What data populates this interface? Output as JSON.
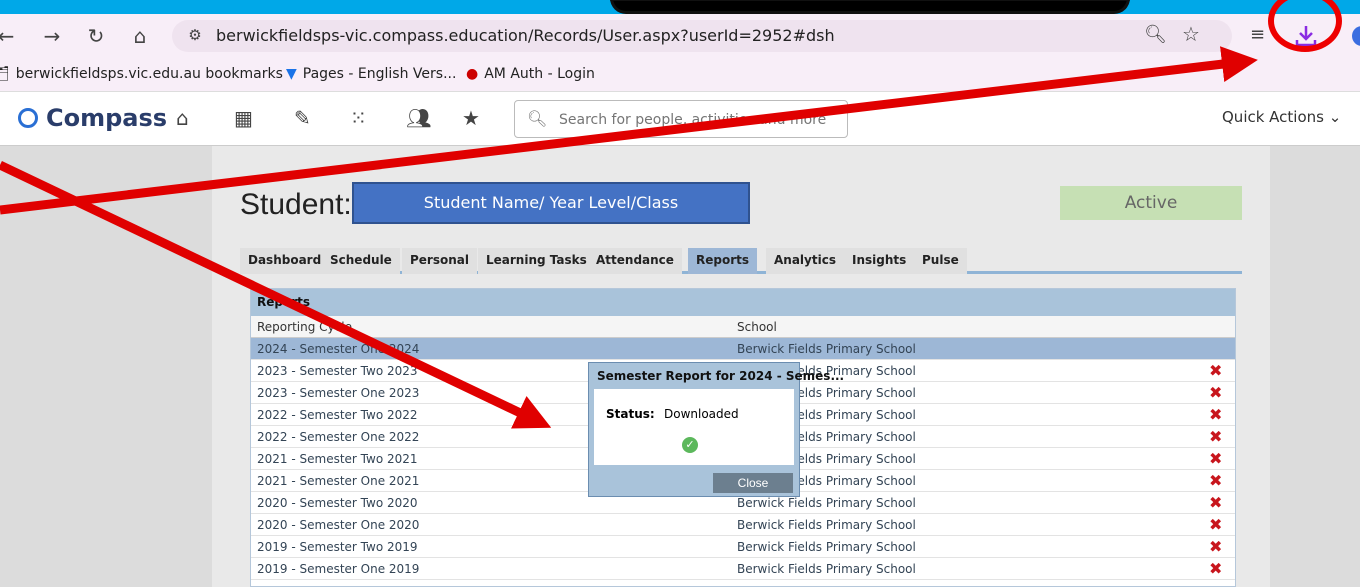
{
  "browser": {
    "url": "berwickfieldsps-vic.compass.education/Records/User.aspx?userId=2952#dsh",
    "bookmarks": [
      {
        "label": "berwickfieldsps.vic.edu.au bookmarks",
        "icon": "folder-gear-icon"
      },
      {
        "label": "Pages - English Vers...",
        "icon": "chevron-logo-icon"
      },
      {
        "label": "AM Auth - Login",
        "icon": "auth-logo-icon"
      }
    ]
  },
  "compass": {
    "logo": "Compass",
    "search_placeholder": "Search for people, activities and more",
    "quick_actions": "Quick Actions"
  },
  "student": {
    "title": "Student:",
    "name_box": "Student Name/ Year Level/Class",
    "status": "Active"
  },
  "tabs": [
    "Dashboard",
    "Schedule",
    "Personal",
    "Learning Tasks",
    "Attendance",
    "Reports",
    "Analytics",
    "Insights",
    "Pulse"
  ],
  "active_tab": "Reports",
  "reports": {
    "heading": "Reports",
    "columns": {
      "cycle": "Reporting Cycle",
      "school": "School"
    },
    "rows": [
      {
        "cycle": "2024 - Semester One 2024",
        "school": "Berwick Fields Primary School"
      },
      {
        "cycle": "2023 - Semester Two 2023",
        "school": "Berwick Fields Primary School"
      },
      {
        "cycle": "2023 - Semester One 2023",
        "school": "Berwick Fields Primary School"
      },
      {
        "cycle": "2022 - Semester Two 2022",
        "school": "Berwick Fields Primary School"
      },
      {
        "cycle": "2022 - Semester One 2022",
        "school": "Berwick Fields Primary School"
      },
      {
        "cycle": "2021 - Semester Two 2021",
        "school": "Berwick Fields Primary School"
      },
      {
        "cycle": "2021 - Semester One 2021",
        "school": "Berwick Fields Primary School"
      },
      {
        "cycle": "2020 - Semester Two 2020",
        "school": "Berwick Fields Primary School"
      },
      {
        "cycle": "2020 - Semester One 2020",
        "school": "Berwick Fields Primary School"
      },
      {
        "cycle": "2019 - Semester Two 2019",
        "school": "Berwick Fields Primary School"
      },
      {
        "cycle": "2019 - Semester One 2019",
        "school": "Berwick Fields Primary School"
      }
    ]
  },
  "modal": {
    "title": "Semester Report for 2024 - Semes...",
    "status_label": "Status:",
    "status_value": "Downloaded",
    "close_label": "Close"
  },
  "colors": {
    "background": "#00a8e8",
    "annotation_red": "#e00000",
    "name_box": "#4472c4",
    "active_badge": "#c6e0b4"
  }
}
